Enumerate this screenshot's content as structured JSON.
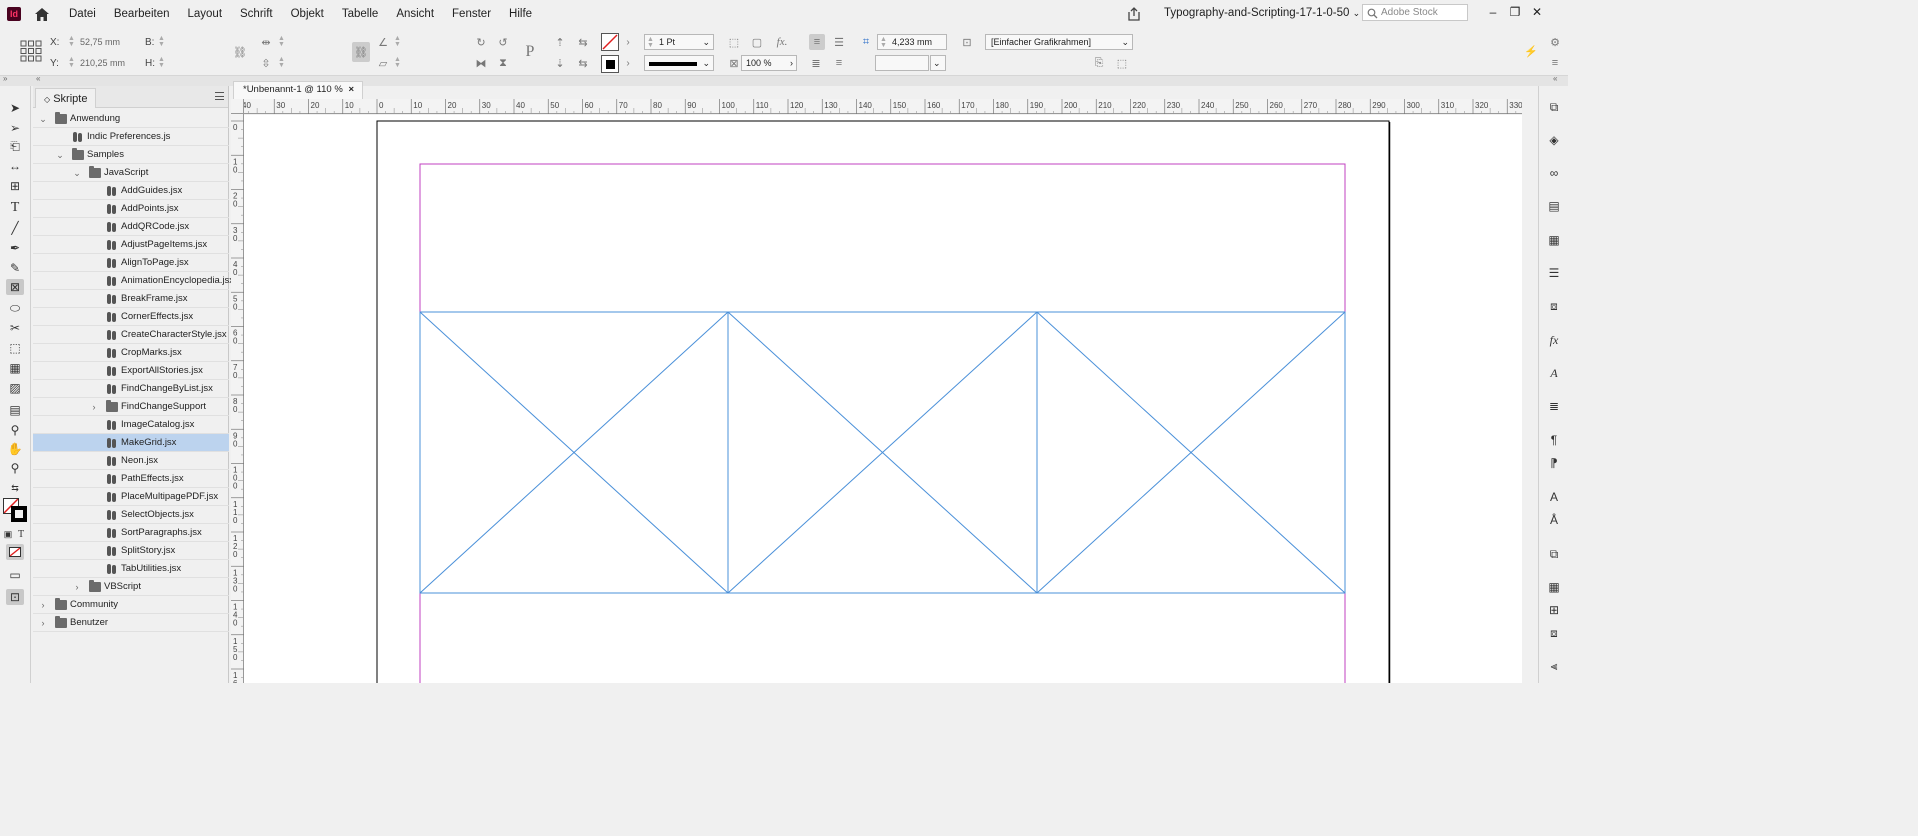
{
  "menu": {
    "items": [
      "Datei",
      "Bearbeiten",
      "Layout",
      "Schrift",
      "Objekt",
      "Tabelle",
      "Ansicht",
      "Fenster",
      "Hilfe"
    ],
    "app_icon": "Id",
    "doc_title": "Typography-and-Scripting-17-1-0-50",
    "search_placeholder": "Adobe Stock"
  },
  "control": {
    "x_label": "X:",
    "x_value": "52,75 mm",
    "y_label": "Y:",
    "y_value": "210,25 mm",
    "b_label": "B:",
    "h_label": "H:",
    "stroke_weight": "1 Pt",
    "opacity": "100 %",
    "corner_size": "4,233 mm",
    "object_style": "[Einfacher Grafikrahmen]",
    "fx_label": "fx."
  },
  "scripts_panel": {
    "title": "Skripte",
    "tree": [
      {
        "label": "Anwendung",
        "type": "folder",
        "level": 0,
        "arrow": "open"
      },
      {
        "label": "Indic Preferences.js",
        "type": "script",
        "level": 1,
        "arrow": "none"
      },
      {
        "label": "Samples",
        "type": "folder",
        "level": 1,
        "arrow": "open"
      },
      {
        "label": "JavaScript",
        "type": "folder",
        "level": 2,
        "arrow": "open"
      },
      {
        "label": "AddGuides.jsx",
        "type": "script",
        "level": 3,
        "arrow": "none"
      },
      {
        "label": "AddPoints.jsx",
        "type": "script",
        "level": 3,
        "arrow": "none"
      },
      {
        "label": "AddQRCode.jsx",
        "type": "script",
        "level": 3,
        "arrow": "none"
      },
      {
        "label": "AdjustPageItems.jsx",
        "type": "script",
        "level": 3,
        "arrow": "none"
      },
      {
        "label": "AlignToPage.jsx",
        "type": "script",
        "level": 3,
        "arrow": "none"
      },
      {
        "label": "AnimationEncyclopedia.jsx",
        "type": "script",
        "level": 3,
        "arrow": "none"
      },
      {
        "label": "BreakFrame.jsx",
        "type": "script",
        "level": 3,
        "arrow": "none"
      },
      {
        "label": "CornerEffects.jsx",
        "type": "script",
        "level": 3,
        "arrow": "none"
      },
      {
        "label": "CreateCharacterStyle.jsx",
        "type": "script",
        "level": 3,
        "arrow": "none"
      },
      {
        "label": "CropMarks.jsx",
        "type": "script",
        "level": 3,
        "arrow": "none"
      },
      {
        "label": "ExportAllStories.jsx",
        "type": "script",
        "level": 3,
        "arrow": "none"
      },
      {
        "label": "FindChangeByList.jsx",
        "type": "script",
        "level": 3,
        "arrow": "none"
      },
      {
        "label": "FindChangeSupport",
        "type": "folder",
        "level": 3,
        "arrow": "closed"
      },
      {
        "label": "ImageCatalog.jsx",
        "type": "script",
        "level": 3,
        "arrow": "none"
      },
      {
        "label": "MakeGrid.jsx",
        "type": "script",
        "level": 3,
        "arrow": "none",
        "selected": true
      },
      {
        "label": "Neon.jsx",
        "type": "script",
        "level": 3,
        "arrow": "none"
      },
      {
        "label": "PathEffects.jsx",
        "type": "script",
        "level": 3,
        "arrow": "none"
      },
      {
        "label": "PlaceMultipagePDF.jsx",
        "type": "script",
        "level": 3,
        "arrow": "none"
      },
      {
        "label": "SelectObjects.jsx",
        "type": "script",
        "level": 3,
        "arrow": "none"
      },
      {
        "label": "SortParagraphs.jsx",
        "type": "script",
        "level": 3,
        "arrow": "none"
      },
      {
        "label": "SplitStory.jsx",
        "type": "script",
        "level": 3,
        "arrow": "none"
      },
      {
        "label": "TabUtilities.jsx",
        "type": "script",
        "level": 3,
        "arrow": "none"
      },
      {
        "label": "VBScript",
        "type": "folder",
        "level": 2,
        "arrow": "closed"
      },
      {
        "label": "Community",
        "type": "folder",
        "level": 0,
        "arrow": "closed"
      },
      {
        "label": "Benutzer",
        "type": "folder",
        "level": 0,
        "arrow": "closed"
      }
    ]
  },
  "document": {
    "tab_label": "*Unbenannt-1 @ 110 %",
    "close_glyph": "×",
    "h_ruler_labels": [
      "40",
      "30",
      "20",
      "10",
      "0",
      "10",
      "20",
      "30",
      "40",
      "50",
      "60",
      "70",
      "80",
      "90",
      "100",
      "110",
      "120",
      "130",
      "140",
      "150",
      "160",
      "170",
      "180",
      "190",
      "200",
      "210",
      "220",
      "230",
      "240",
      "250",
      "260",
      "270",
      "280",
      "290",
      "300",
      "310",
      "320",
      "330"
    ],
    "v_ruler_labels": [
      "0",
      "10",
      "20",
      "30",
      "40",
      "50",
      "60",
      "70",
      "80",
      "90",
      "100",
      "110",
      "120",
      "130",
      "140",
      "150",
      "160"
    ]
  },
  "colors": {
    "margin_guide": "#c040c0",
    "frame_stroke": "#4a90d9",
    "selection": "#bcd3ee"
  }
}
